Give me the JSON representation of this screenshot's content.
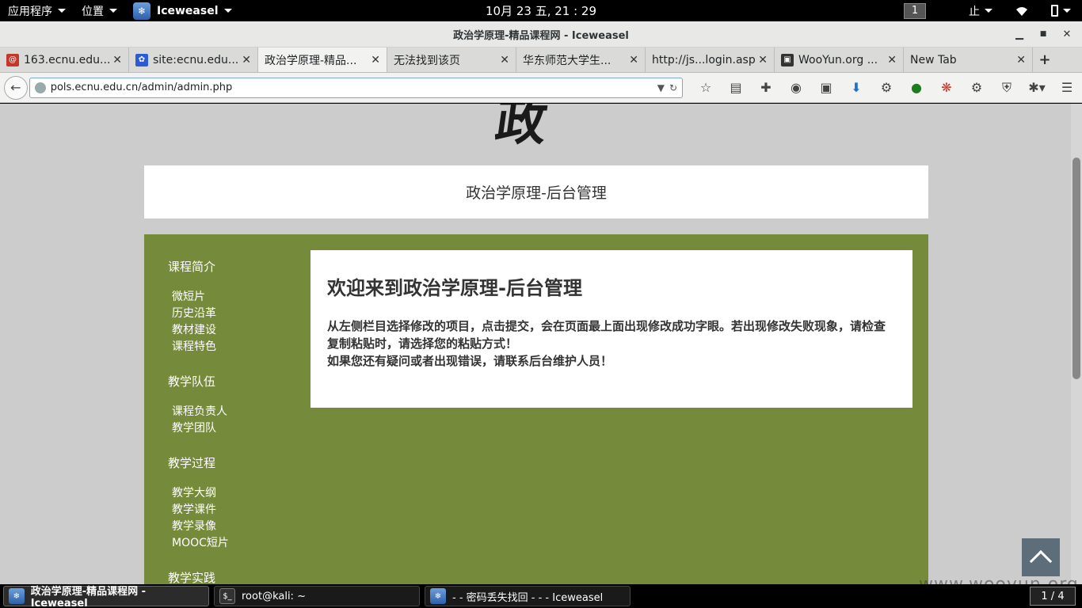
{
  "topbar": {
    "apps_label": "应用程序",
    "places_label": "位置",
    "app_name": "Iceweasel",
    "clock": "10月 23 五, 21 : 29",
    "workspace": "1",
    "input_method": "止"
  },
  "window": {
    "title": "政治学原理-精品课程网 - Iceweasel"
  },
  "tabs": [
    {
      "label": "163.ecnu.edu....",
      "favicon_color": "#c0392b",
      "favicon_glyph": "@"
    },
    {
      "label": "site:ecnu.edu....",
      "favicon_color": "#2d5bd6",
      "favicon_glyph": "🐾"
    },
    {
      "label": "政治学原理-精品...",
      "favicon_color": "",
      "favicon_glyph": ""
    },
    {
      "label": "无法找到该页",
      "favicon_color": "",
      "favicon_glyph": ""
    },
    {
      "label": "华东师范大学生...",
      "favicon_color": "",
      "favicon_glyph": ""
    },
    {
      "label": "http://js...login.asp",
      "favicon_color": "",
      "favicon_glyph": ""
    },
    {
      "label": "WooYun.org ...",
      "favicon_color": "#333333",
      "favicon_glyph": "▣"
    },
    {
      "label": "New Tab",
      "favicon_color": "",
      "favicon_glyph": ""
    }
  ],
  "nav": {
    "url": "pols.ecnu.edu.cn/admin/admin.php"
  },
  "page": {
    "logo_glyph": "政",
    "header_title": "政治学原理-后台管理",
    "sidebar": [
      {
        "title": "课程简介",
        "items": [
          "微短片",
          "历史沿革",
          "教材建设",
          "课程特色"
        ]
      },
      {
        "title": "教学队伍",
        "items": [
          "课程负责人",
          "教学团队"
        ]
      },
      {
        "title": "教学过程",
        "items": [
          "教学大纲",
          "教学课件",
          "教学录像",
          "MOOC短片"
        ]
      },
      {
        "title": "教学实践",
        "items": []
      }
    ],
    "welcome_heading": "欢迎来到政治学原理-后台管理",
    "welcome_line1": "从左侧栏目选择修改的项目，点击提交，会在页面最上面出现修改成功字眼。若出现修改失败现象，请检查复制粘贴时，请选择您的粘贴方式！",
    "welcome_line2": "如果您还有疑问或者出现错误，请联系后台维护人员！"
  },
  "watermark": "www.wooyun.org",
  "taskbar": {
    "tasks": [
      {
        "label": "政治学原理-精品课程网 - Iceweasel",
        "active": true
      },
      {
        "label": "root@kali: ~",
        "active": false
      },
      {
        "label": "- - 密码丢失找回 - - - Iceweasel",
        "active": false
      }
    ],
    "pager": "1 / 4"
  }
}
